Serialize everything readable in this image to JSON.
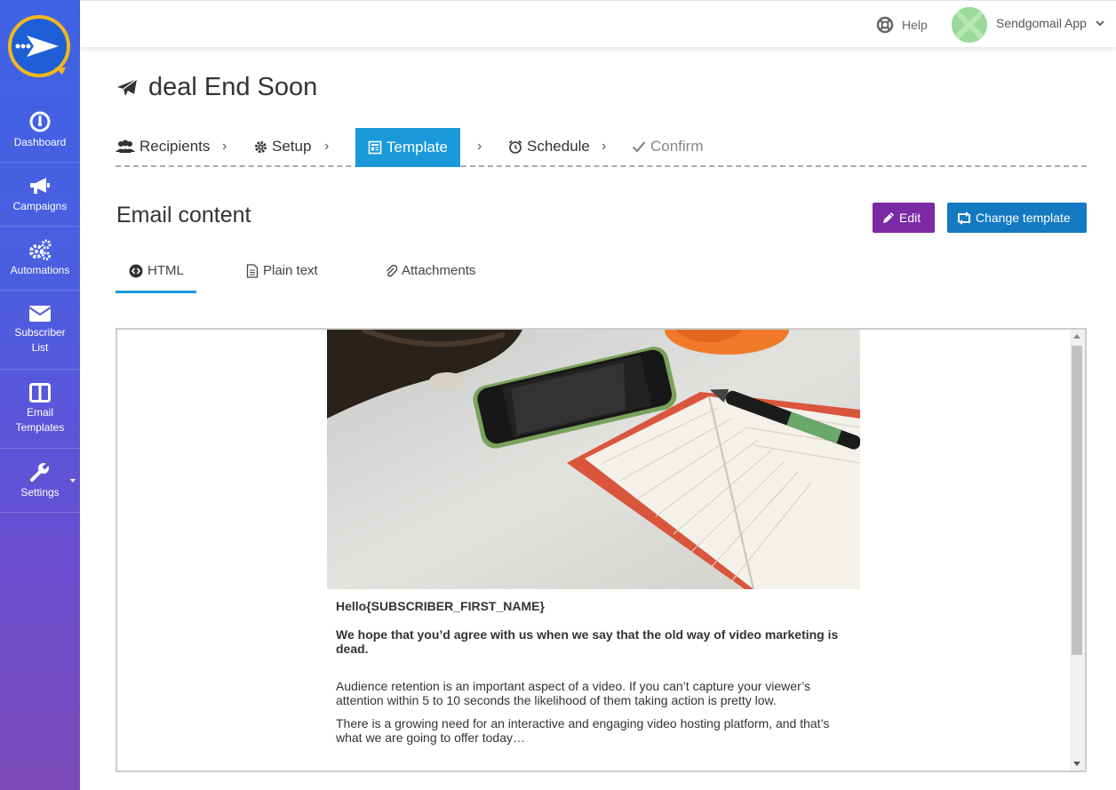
{
  "brand": {
    "accent": "#1a9ad8",
    "edit_color": "#7b2aa4",
    "change_color": "#1379c1"
  },
  "sidebar": {
    "items": [
      {
        "label": "Dashboard",
        "icon": "dashboard-icon"
      },
      {
        "label": "Campaigns",
        "icon": "megaphone-icon"
      },
      {
        "label": "Automations",
        "icon": "cogs-icon"
      },
      {
        "label": "Subscriber List",
        "icon": "envelope-icon"
      },
      {
        "label": "Email Templates",
        "icon": "columns-icon"
      },
      {
        "label": "Settings",
        "icon": "wrench-icon"
      }
    ]
  },
  "topbar": {
    "help_label": "Help",
    "user_name": "Sendgomail App"
  },
  "page": {
    "title": "deal End Soon"
  },
  "steps": [
    {
      "label": "Recipients",
      "icon": "users-icon"
    },
    {
      "label": "Setup",
      "icon": "gear-icon"
    },
    {
      "label": "Template",
      "icon": "template-icon"
    },
    {
      "label": "Schedule",
      "icon": "alarm-clock-icon"
    },
    {
      "label": "Confirm",
      "icon": "check-icon"
    }
  ],
  "content": {
    "title": "Email content",
    "edit_label": "Edit",
    "change_label": "Change template"
  },
  "tabs": [
    {
      "label": "HTML",
      "icon": "code-icon"
    },
    {
      "label": "Plain text",
      "icon": "document-icon"
    },
    {
      "label": "Attachments",
      "icon": "paperclip-icon"
    }
  ],
  "email": {
    "greeting": "Hello{SUBSCRIBER_FIRST_NAME}",
    "lead": "We hope that you’d agree with us when we say that the old way of video marketing is dead.",
    "p1": "Audience retention is an important aspect of a video. If you can’t capture your viewer’s attention within 5 to 10 seconds the likelihood of them taking action is pretty low.",
    "p2": "There is a growing need for an interactive and engaging video hosting platform, and that’s what we are going to offer today…"
  }
}
